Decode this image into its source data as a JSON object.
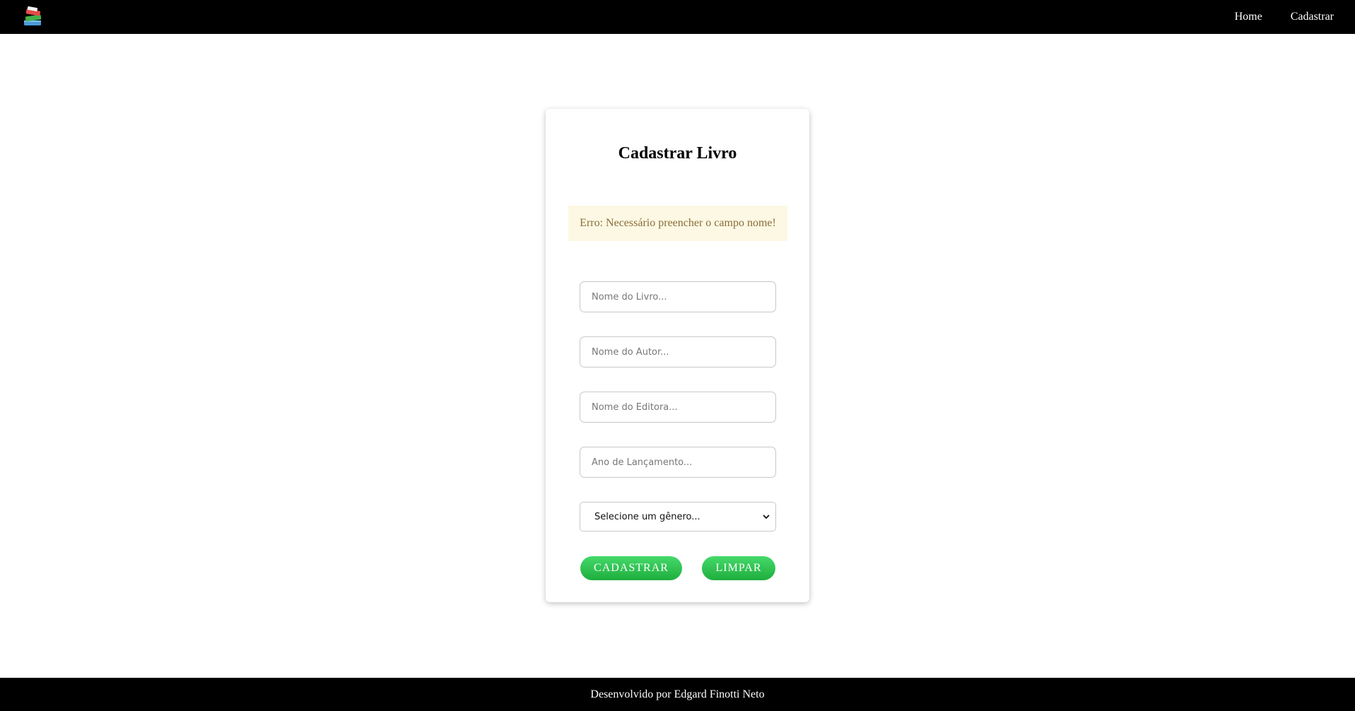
{
  "navbar": {
    "logo_icon": "books-stack-icon",
    "links": [
      {
        "label": "Home"
      },
      {
        "label": "Cadastrar"
      }
    ]
  },
  "form": {
    "title": "Cadastrar Livro",
    "error_message": "Erro: Necessário preencher o campo nome!",
    "fields": {
      "book_name": {
        "value": "",
        "placeholder": "Nome do Livro..."
      },
      "author_name": {
        "value": "",
        "placeholder": "Nome do Autor..."
      },
      "publisher_name": {
        "value": "",
        "placeholder": "Nome do Editora..."
      },
      "release_year": {
        "value": "",
        "placeholder": "Ano de Lançamento..."
      }
    },
    "genre_select": {
      "selected": "Selecione um gênero..."
    },
    "buttons": {
      "submit_label": "CADASTRAR",
      "clear_label": "LIMPAR"
    }
  },
  "footer": {
    "text": "Desenvolvido por Edgard Finotti Neto"
  },
  "colors": {
    "navbar_bg": "#000000",
    "alert_bg": "#fcf8e3",
    "alert_text": "#8a6d3b",
    "button_green": "#2ec24f"
  }
}
